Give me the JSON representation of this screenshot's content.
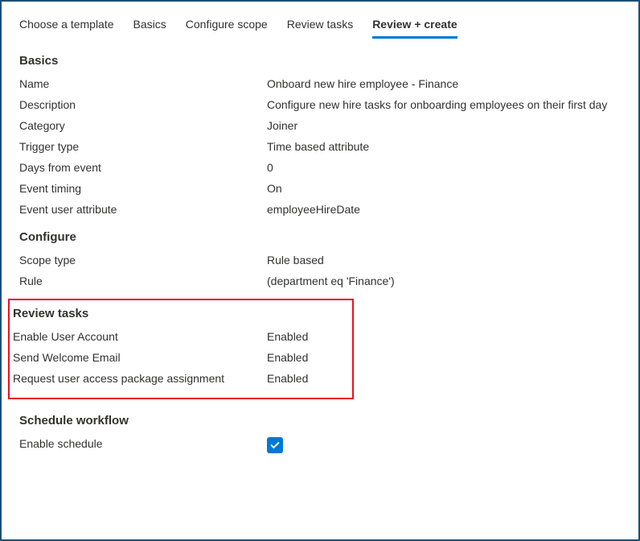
{
  "tabs": {
    "choose_template": "Choose a template",
    "basics": "Basics",
    "configure_scope": "Configure scope",
    "review_tasks": "Review tasks",
    "review_create": "Review + create"
  },
  "sections": {
    "basics": {
      "heading": "Basics",
      "name_label": "Name",
      "name_value": "Onboard new hire employee - Finance",
      "description_label": "Description",
      "description_value": "Configure new hire tasks for onboarding employees on their first day",
      "category_label": "Category",
      "category_value": "Joiner",
      "trigger_type_label": "Trigger type",
      "trigger_type_value": "Time based attribute",
      "days_from_event_label": "Days from event",
      "days_from_event_value": "0",
      "event_timing_label": "Event timing",
      "event_timing_value": "On",
      "event_user_attribute_label": "Event user attribute",
      "event_user_attribute_value": "employeeHireDate"
    },
    "configure": {
      "heading": "Configure",
      "scope_type_label": "Scope type",
      "scope_type_value": "Rule based",
      "rule_label": "Rule",
      "rule_value": " (department eq 'Finance')"
    },
    "review_tasks": {
      "heading": "Review tasks",
      "task1_label": "Enable User Account",
      "task1_value": "Enabled",
      "task2_label": "Send Welcome Email",
      "task2_value": "Enabled",
      "task3_label": "Request user access package assignment",
      "task3_value": "Enabled"
    },
    "schedule": {
      "heading": "Schedule workflow",
      "enable_schedule_label": "Enable schedule"
    }
  }
}
